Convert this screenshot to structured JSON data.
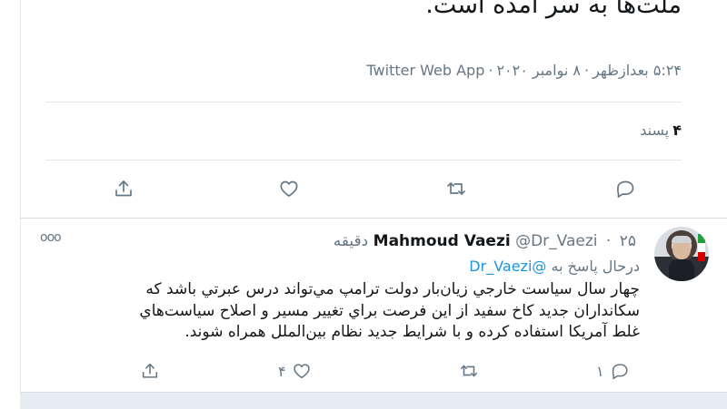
{
  "main_tweet": {
    "text_lines": [
      "ملت‌ها به سر آمده است."
    ],
    "meta": {
      "time": "۵:۲۴ بعدازظهر",
      "date": "۸ نوامبر ۲۰۲۰",
      "source": "Twitter Web App",
      "separator": "·"
    },
    "likes": {
      "count": "۴",
      "label": "پسند"
    }
  },
  "reply_tweet": {
    "name": "Mahmoud Vaezi",
    "handle": "@Dr_Vaezi",
    "time_ago": "۲۵ دقیقه",
    "separator": "·",
    "replying_prefix": "درحال پاسخ به",
    "replying_to": "@Dr_Vaezi",
    "body_lines": [
      "چهار سال سياست خارجي زيان‌بار دولت ترامپ مي‌تواند درس عبرتي باشد كه",
      "سكانداران جديد كاخ سفيد از اين فرصت براي تغيير مسير و اصلاح سياست‌هاي",
      "غلط آمريكا استفاده كرده و با شرايط جديد نظام بين‌الملل همراه شوند."
    ],
    "more_label": "ooo",
    "reply_count": "۱",
    "like_count": "۴"
  },
  "icons": {
    "reply": "reply-icon",
    "retweet": "retweet-icon",
    "like": "heart-icon",
    "share": "share-icon"
  }
}
